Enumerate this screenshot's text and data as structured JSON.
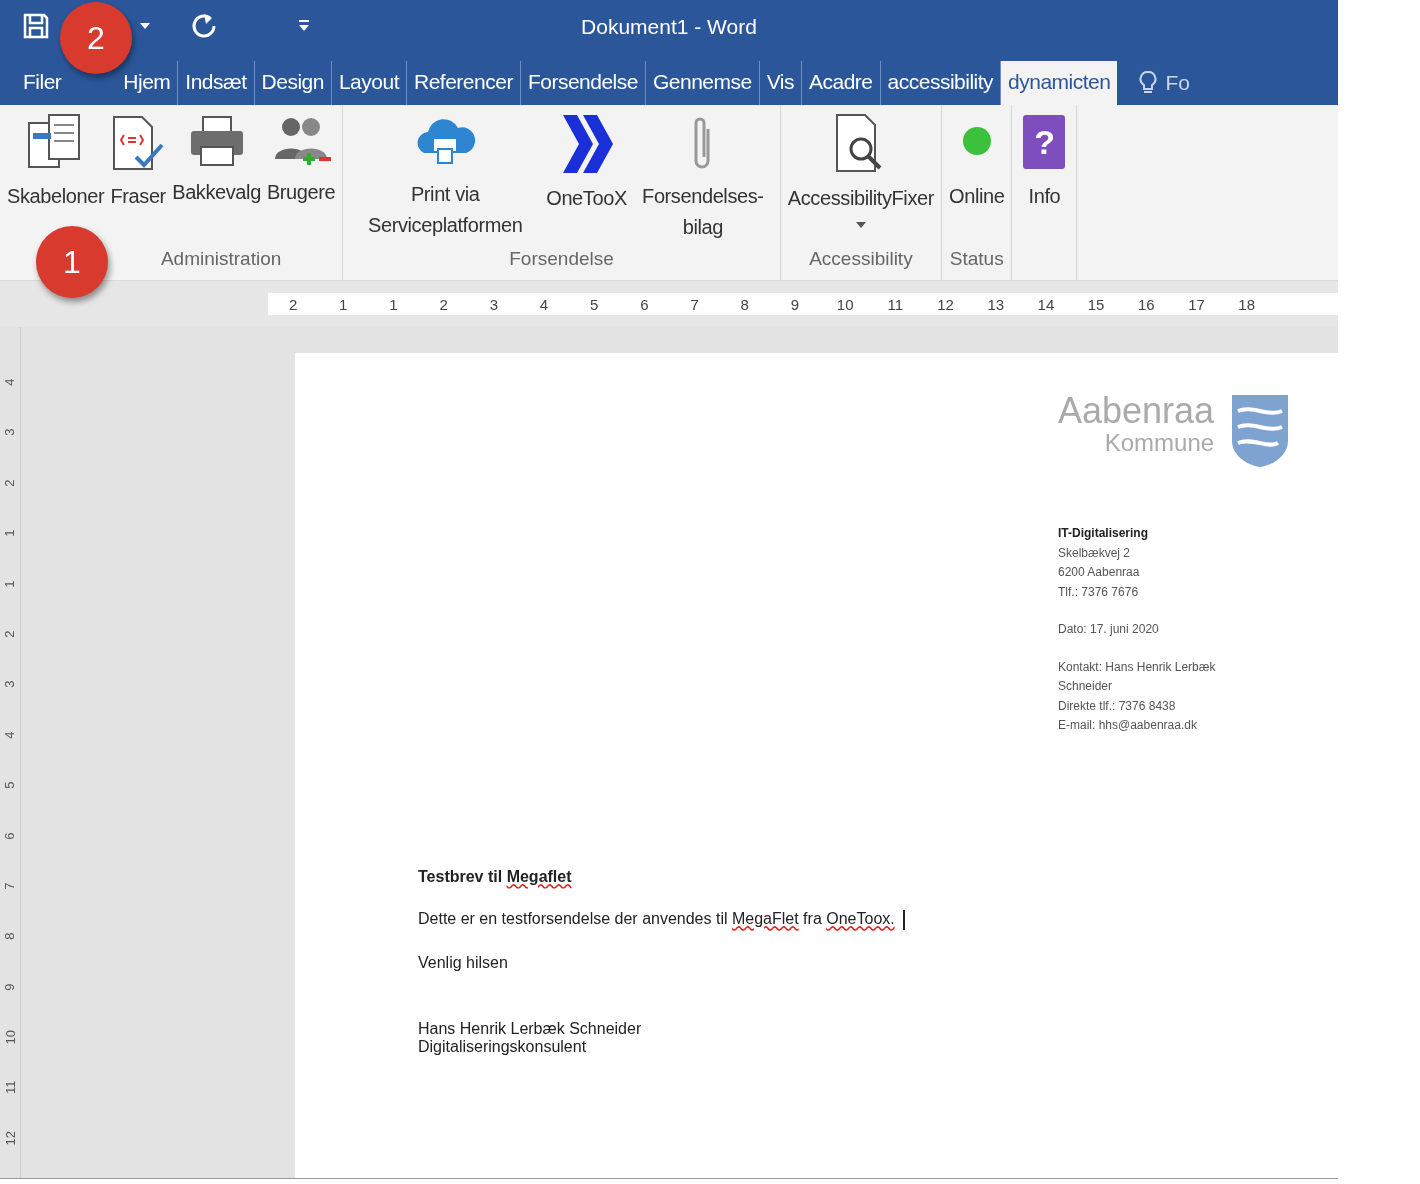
{
  "window": {
    "title": "Dokument1 - Word"
  },
  "quick_access": [
    {
      "kind": "save"
    },
    {
      "kind": "caret"
    },
    {
      "kind": "redo"
    },
    {
      "kind": "customize"
    }
  ],
  "tabs": [
    {
      "label": "Filer",
      "selected": false
    },
    {
      "label": "Hjem",
      "selected": false
    },
    {
      "label": "Indsæt",
      "selected": false
    },
    {
      "label": "Design",
      "selected": false
    },
    {
      "label": "Layout",
      "selected": false
    },
    {
      "label": "Referencer",
      "selected": false
    },
    {
      "label": "Forsendelse",
      "selected": false
    },
    {
      "label": "Gennemse",
      "selected": false
    },
    {
      "label": "Vis",
      "selected": false
    },
    {
      "label": "Acadre",
      "selected": false
    },
    {
      "label": "accessibility",
      "selected": false
    },
    {
      "label": "dynamicten",
      "selected": true
    }
  ],
  "tell_me": {
    "label": "Fo"
  },
  "ribbon_groups": [
    {
      "label": "Administration",
      "buttons": [
        {
          "label": "Skabeloner",
          "kind": "templates"
        },
        {
          "label": "Fraser",
          "kind": "phrases"
        },
        {
          "label": "Bakkevalg",
          "kind": "printer"
        },
        {
          "label": "Brugere",
          "kind": "users"
        }
      ]
    },
    {
      "label": "Forsendelse",
      "buttons": [
        {
          "label": "Print via Serviceplatformen",
          "kind": "cloud"
        },
        {
          "label": "OneTooX",
          "kind": "chevrons"
        },
        {
          "label": "Forsendelses-bilag",
          "kind": "paperclip"
        }
      ]
    },
    {
      "label": "Accessibility",
      "buttons": [
        {
          "label": "AccessibilityFixer",
          "kind": "magnifier",
          "dropdown": true
        }
      ]
    },
    {
      "label": "Status",
      "buttons": [
        {
          "label": "Online",
          "kind": "status_dot",
          "color": "#3cc13c"
        }
      ]
    },
    {
      "buttons": [
        {
          "label": "Info",
          "kind": "help",
          "icon_text": "?"
        }
      ]
    }
  ],
  "ruler": {
    "labels": [
      "2",
      "1",
      "1",
      "2",
      "3",
      "4",
      "5",
      "6",
      "7",
      "8",
      "9",
      "10",
      "11",
      "12",
      "13",
      "14",
      "15",
      "16",
      "17",
      "18"
    ]
  },
  "vertical_ruler": {
    "labels": [
      "4",
      "3",
      "2",
      "1",
      "1",
      "2",
      "3",
      "4",
      "5",
      "6",
      "7",
      "8",
      "9",
      "10",
      "11",
      "12"
    ]
  },
  "callouts": [
    {
      "label": "2"
    },
    {
      "label": "1"
    }
  ],
  "document": {
    "logo": {
      "name": "Aabenraa",
      "subtitle": "Kommune"
    },
    "sender": [
      {
        "text": "IT-Digitalisering",
        "bold": true
      },
      {
        "text": "Skelbækvej 2",
        "bold": false
      },
      {
        "text": "6200 Aabenraa",
        "bold": false
      },
      {
        "text": "Tlf.: 7376 7676",
        "bold": false
      }
    ],
    "date": "Dato: 17. juni 2020",
    "contact": [
      "Kontakt: Hans Henrik Lerbæk",
      "Schneider",
      "Direkte tlf.: 7376 8438",
      "E-mail: hhs@aabenraa.dk"
    ],
    "heading": [
      {
        "text": "Testbrev til ",
        "misspelled": false
      },
      {
        "text": "Megaflet",
        "misspelled": true
      }
    ],
    "body": [
      {
        "text": "Dette er en testforsendelse der anvendes til ",
        "misspelled": false
      },
      {
        "text": "MegaFlet",
        "misspelled": true
      },
      {
        "text": " fra ",
        "misspelled": false
      },
      {
        "text": "OneToox.",
        "misspelled": true
      }
    ],
    "closing": "Venlig hilsen",
    "signature": [
      "Hans Henrik Lerbæk Schneider",
      "Digitaliseringskonsulent"
    ]
  }
}
